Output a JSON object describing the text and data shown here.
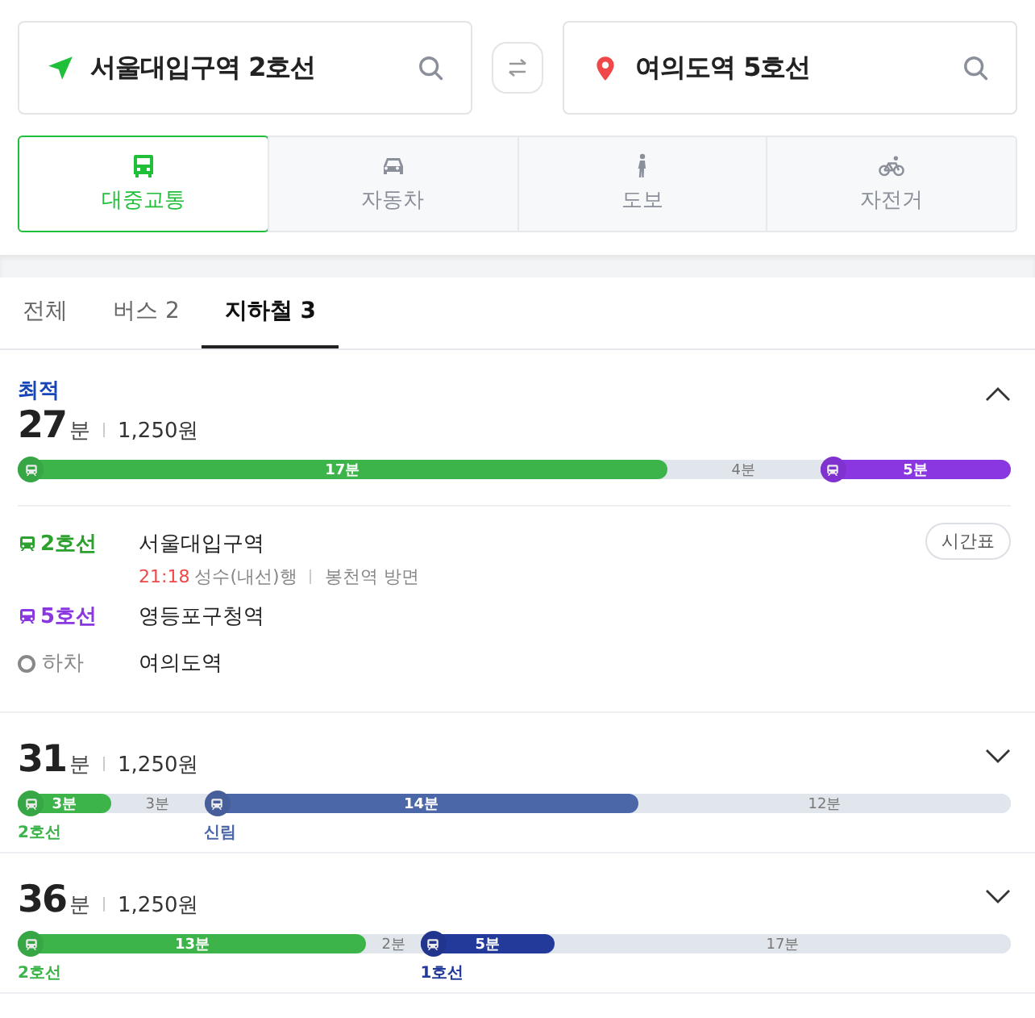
{
  "search": {
    "origin": "서울대입구역 2호선",
    "destination": "여의도역 5호선"
  },
  "modes": [
    {
      "kind": "transit",
      "label": "대중교통",
      "selected": true
    },
    {
      "kind": "car",
      "label": "자동차",
      "selected": false
    },
    {
      "kind": "walk",
      "label": "도보",
      "selected": false
    },
    {
      "kind": "bike",
      "label": "자전거",
      "selected": false
    }
  ],
  "tabs": [
    {
      "label": "전체",
      "selected": false
    },
    {
      "label": "버스",
      "count": "2",
      "selected": false
    },
    {
      "label": "지하철",
      "count": "3",
      "selected": true
    }
  ],
  "routes": [
    {
      "badge": "최적",
      "minutes": "27",
      "unit": "분",
      "fare": "1,250원",
      "expanded": true,
      "segments": [
        {
          "kind": "ride",
          "color": "#3cb44a",
          "text": "17분"
        },
        {
          "kind": "walk",
          "text": "4분"
        },
        {
          "kind": "ride",
          "color": "#8a36e1",
          "text": "5분"
        }
      ],
      "steps": [
        {
          "kind": "line",
          "color": "#2ca12f",
          "line": "2호선",
          "station": "서울대입구역",
          "time": "21:18",
          "direction": "성수(내선)행",
          "exit": "봉천역 방면",
          "button": "시간표"
        },
        {
          "kind": "line",
          "color": "#8a36e1",
          "line": "5호선",
          "station": "영등포구청역"
        },
        {
          "kind": "alight",
          "line": "하차",
          "station": "여의도역"
        }
      ]
    },
    {
      "minutes": "31",
      "unit": "분",
      "fare": "1,250원",
      "expanded": false,
      "segments": [
        {
          "kind": "ride",
          "color": "#3cb44a",
          "text": "3분",
          "label": "2호선"
        },
        {
          "kind": "walk",
          "text": "3분"
        },
        {
          "kind": "ride",
          "color": "#4c67a8",
          "text": "14분",
          "label": "신림"
        },
        {
          "kind": "walk",
          "text": "12분"
        }
      ]
    },
    {
      "minutes": "36",
      "unit": "분",
      "fare": "1,250원",
      "expanded": false,
      "segments": [
        {
          "kind": "ride",
          "color": "#3cb44a",
          "text": "13분",
          "label": "2호선"
        },
        {
          "kind": "walk",
          "text": "2분"
        },
        {
          "kind": "ride",
          "color": "#243a9a",
          "text": "5분",
          "label": "1호선"
        },
        {
          "kind": "walk",
          "text": "17분"
        }
      ]
    }
  ]
}
